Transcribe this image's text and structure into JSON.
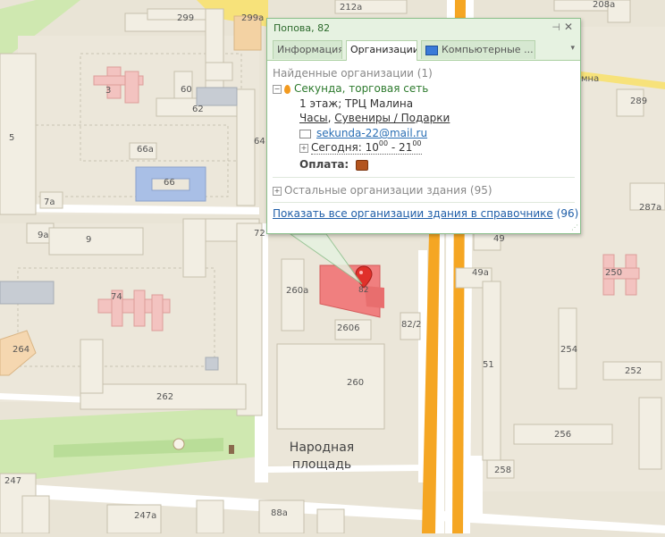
{
  "map_labels": {
    "b299": "299",
    "b299a": "299а",
    "b212a": "212а",
    "b208a": "208а",
    "b3": "3",
    "b60": "60",
    "b62": "62",
    "b5": "5",
    "b64": "64",
    "b66a": "66а",
    "b66": "66",
    "b7a": "7а",
    "b9a": "9а",
    "b9": "9",
    "b72": "72",
    "b74": "74",
    "b264": "264",
    "b262": "262",
    "b260a": "260а",
    "b82": "82",
    "b2606": "2606",
    "b82_2": "82/2",
    "b260": "260",
    "b49": "49",
    "b49a": "49а",
    "b51": "51",
    "b254": "254",
    "b252": "252",
    "b256": "256",
    "b258": "258",
    "b250": "250",
    "b289": "289",
    "b287a": "287а",
    "b247": "247",
    "b247a": "247а",
    "b88a": "88а",
    "street_fragment": "мна",
    "square_line1": "Народная",
    "square_line2": "площадь"
  },
  "popup": {
    "title": "Попова, 82",
    "tabs": [
      "Информация",
      "Организации",
      "Компьютерные ..."
    ],
    "found_label": "Найденные организации (1)",
    "org_name": "Секунда, торговая сеть",
    "org_location": "1 этаж; ТРЦ Малина",
    "cat1": "Часы",
    "cat_sep": ", ",
    "cat2": "Сувениры / Подарки",
    "email": "sekunda-22@mail.ru",
    "hours_prefix": "Сегодня: 10",
    "hours_open_min": "00",
    "hours_mid": " - 21",
    "hours_close_min": "00",
    "payment_label": "Оплата:",
    "other_orgs": "Остальные организации здания (95)",
    "show_all_link": "Показать все организации здания в справочнике",
    "show_all_count": "(96)"
  },
  "colors": {
    "popup_border": "#8cc08c",
    "popup_header_bg": "#e6f2e1",
    "org_name": "#2d7a2d",
    "email_link": "#2a6fb5",
    "selected_building": "#f07f7f",
    "main_road": "#f5a623",
    "park": "#cfe8b0"
  }
}
